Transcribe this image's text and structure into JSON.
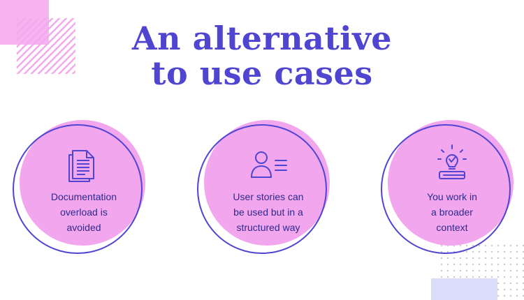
{
  "title": {
    "line1": "An alternative",
    "line2": "to use cases"
  },
  "cards": [
    {
      "icon": "document-icon",
      "lines": [
        "Documentation",
        "overload is",
        "avoided"
      ]
    },
    {
      "icon": "user-list-icon",
      "lines": [
        "User stories can",
        "be used but in a",
        "structured way"
      ]
    },
    {
      "icon": "lightbulb-book-icon",
      "lines": [
        "You work in",
        "a broader",
        "context"
      ]
    }
  ],
  "colors": {
    "title": "#4f45d1",
    "circle": "#f2a6ed",
    "ring": "#4f45d1",
    "text": "#2f2a8c",
    "accent_lavender": "#dcdcfb"
  }
}
